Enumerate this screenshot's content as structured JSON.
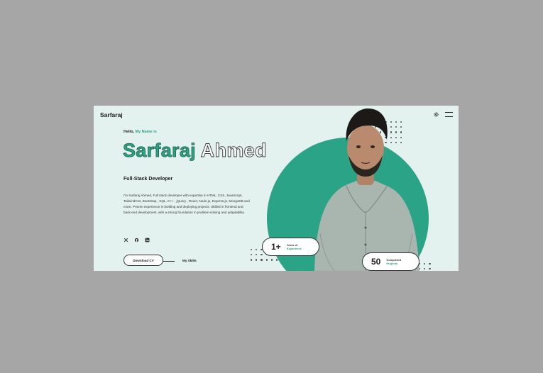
{
  "header": {
    "brand": "Sarfaraj",
    "settings_icon": "gear-icon",
    "menu_icon": "menu-icon"
  },
  "hero": {
    "greeting": "Hello,",
    "greeting_accent": "My Name is",
    "first_name": "Sarfaraj",
    "last_name": "Ahmed",
    "role": "Full-Stack Developer",
    "bio": "I'm Sarfaraj Ahmed, Full stack developer with expertise in HTML, CSS, JavaScript, TailwindCss, Bootstrap , SQL, C++ , jQuery , React, Node.js, Express.js, MongoDB and more. Proven experience in building and deploying projects. Skilled in frontend and back-end development, with a strong foundation in problem-solving and adaptability.",
    "socials": [
      "x-icon",
      "github-icon",
      "linkedin-icon"
    ],
    "cta_primary": "Download CV",
    "cta_secondary": "My Skills"
  },
  "stats": [
    {
      "value": "1+",
      "label_line1": "Years of",
      "label_line2": "Experience"
    },
    {
      "value": "50",
      "label_line1": "Completed",
      "label_line2": "Projects"
    }
  ],
  "colors": {
    "accent": "#2aa386",
    "background": "#e4f2ef",
    "outer": "#a6a6a6"
  }
}
